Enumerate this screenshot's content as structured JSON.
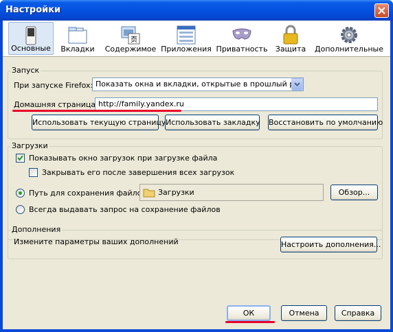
{
  "window": {
    "title": "Настройки"
  },
  "tabs": [
    {
      "label": "Основные",
      "icon": "switch-icon"
    },
    {
      "label": "Вкладки",
      "icon": "tabs-icon"
    },
    {
      "label": "Содержимое",
      "icon": "content-icon"
    },
    {
      "label": "Приложения",
      "icon": "applications-icon"
    },
    {
      "label": "Приватность",
      "icon": "privacy-mask-icon"
    },
    {
      "label": "Защита",
      "icon": "padlock-icon"
    },
    {
      "label": "Дополнительные",
      "icon": "gear-icon"
    }
  ],
  "startup": {
    "group_label": "Запуск",
    "on_start_label": "При запуске Firefox:",
    "on_start_value": "Показать окна и вкладки, открытые в прошлый раз",
    "homepage_label": "Домашняя страница:",
    "homepage_value": "http://family.yandex.ru",
    "use_current": "Использовать текущую страницу",
    "use_bookmark": "Использовать закладку",
    "restore_default": "Восстановить по умолчанию"
  },
  "downloads": {
    "group_label": "Загрузки",
    "show_window": "Показывать окно загрузок при загрузке файла",
    "show_window_checked": true,
    "close_after": "Закрывать его после завершения всех загрузок",
    "close_after_checked": false,
    "save_path_label": "Путь для сохранения файлов",
    "save_path_value": "Загрузки",
    "browse": "Обзор...",
    "always_ask": "Всегда выдавать запрос на сохранение файлов",
    "selected_option": "save_path"
  },
  "addons": {
    "group_label": "Дополнения",
    "description": "Измените параметры ваших дополнений",
    "configure": "Настроить дополнения..."
  },
  "footer": {
    "ok": "ОК",
    "cancel": "Отмена",
    "help": "Справка"
  },
  "colors": {
    "titlebar": "#0552e0",
    "highlight": "#e8002a",
    "dialog_bg": "#ece9d8"
  }
}
